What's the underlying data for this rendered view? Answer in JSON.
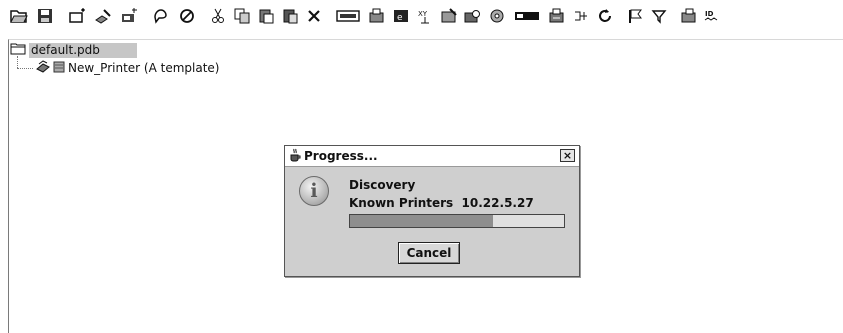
{
  "toolbar": {
    "icons": [
      "open-folder-icon",
      "save-icon",
      "new-printer-icon",
      "edit-printer-icon",
      "printer-star-icon",
      "hand-icon",
      "stop-icon",
      "cut-icon",
      "copy-icon",
      "paste-icon",
      "paste-special-icon",
      "delete-icon",
      "port-icon",
      "printer-config-icon",
      "printer-hp-icon",
      "network-icon",
      "printer-manage-icon",
      "printer-search-icon",
      "printer-settings-icon",
      "bar-icon",
      "printer-queue-icon",
      "branch-icon",
      "refresh-icon",
      "flag-icon",
      "filter-icon",
      "printer-id-icon",
      "id-label-icon"
    ]
  },
  "tree": {
    "root_label": "default.pdb",
    "child_label": "New_Printer (A template)"
  },
  "dialog": {
    "title": "Progress...",
    "close_glyph": "×",
    "message_title": "Discovery",
    "message_detail": "Known Printers  10.22.5.27",
    "progress_fraction": 0.67,
    "cancel_label": "Cancel"
  }
}
